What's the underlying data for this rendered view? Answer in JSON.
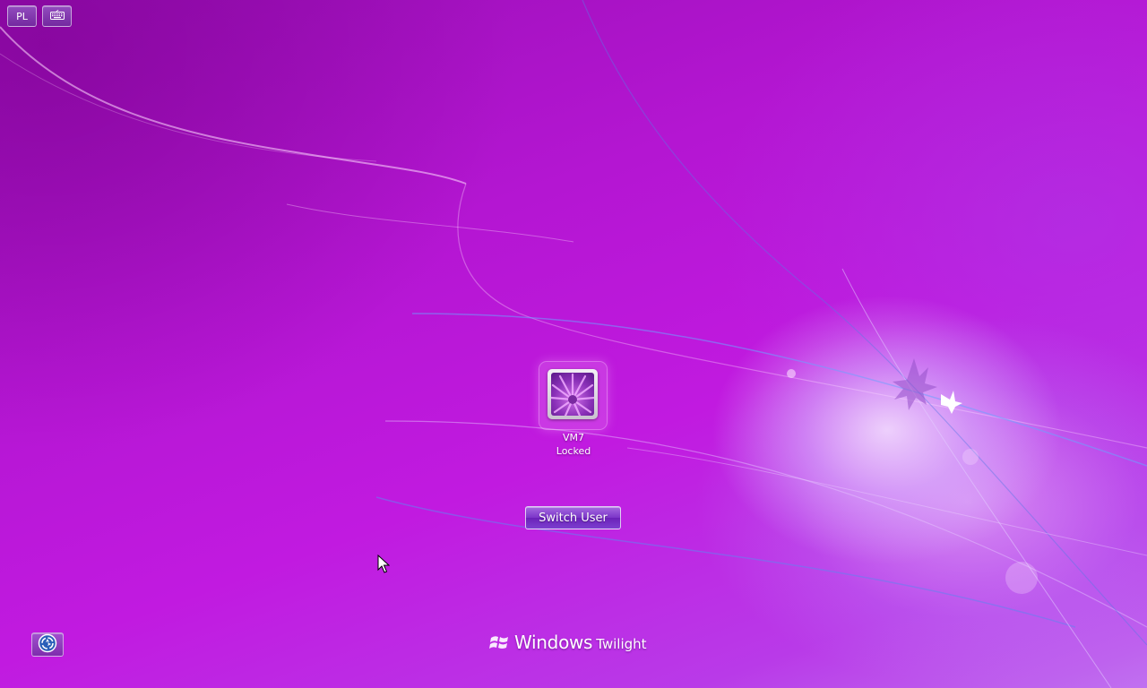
{
  "toolbar": {
    "language_label": "PL",
    "keyboard_icon": "keyboard-icon"
  },
  "user_tile": {
    "name": "VM7",
    "status": "Locked",
    "picture_icon": "purple-flower-picture"
  },
  "actions": {
    "switch_user_label": "Switch User"
  },
  "footer": {
    "ease_of_access_icon": "ease-of-access-icon",
    "brand_word": "Windows",
    "brand_edition": "Twilight"
  },
  "theme": {
    "background": "#b416d2",
    "button_accent": "#7b35c8",
    "text": "#ffffff"
  }
}
